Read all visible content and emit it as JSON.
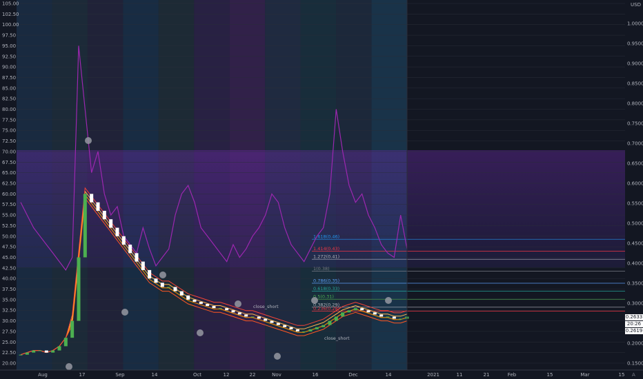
{
  "chart_data": {
    "type": "line",
    "ticker_unit": "USD",
    "y_left": {
      "range": [
        20.0,
        105.0
      ],
      "ticks": [
        "105.00",
        "102.50",
        "100.00",
        "97.50",
        "95.00",
        "92.50",
        "90.00",
        "87.50",
        "85.00",
        "82.50",
        "80.00",
        "77.50",
        "75.00",
        "72.50",
        "70.00",
        "67.50",
        "65.00",
        "62.50",
        "60.00",
        "57.50",
        "55.00",
        "52.50",
        "50.00",
        "47.50",
        "45.00",
        "42.50",
        "40.00",
        "37.50",
        "35.00",
        "32.50",
        "30.00",
        "27.50",
        "25.00",
        "22.50",
        "20.00"
      ]
    },
    "y_right": {
      "range": [
        0.15,
        1.05
      ],
      "ticks": [
        "1.0000",
        "0.9500",
        "0.9000",
        "0.8500",
        "0.8000",
        "0.7500",
        "0.7000",
        "0.6500",
        "0.6000",
        "0.5500",
        "0.5000",
        "0.4500",
        "0.4000",
        "0.3500",
        "0.3000",
        "0.2500",
        "0.2000",
        "0.1500"
      ]
    },
    "x_ticks": [
      "Aug",
      "17",
      "Sep",
      "14",
      "Oct",
      "12",
      "22",
      "Nov",
      "16",
      "Dec",
      "14",
      "2021",
      "11",
      "21",
      "Feb",
      "15",
      "Mar",
      "15"
    ],
    "price_badges": {
      "top": "0.2633",
      "mid": "20:26",
      "bottom": "0.2619"
    },
    "fib_levels": [
      {
        "label": "1.618(0.46)",
        "value": 0.46,
        "color": "#2196f3"
      },
      {
        "label": "1.414(0.43)",
        "value": 0.43,
        "color": "#f23645"
      },
      {
        "label": "1.272(0.41)",
        "value": 0.41,
        "color": "#b2b5be"
      },
      {
        "label": "1(0.38)",
        "value": 0.38,
        "color": "#787b86"
      },
      {
        "label": "0.786(0.35)",
        "value": 0.35,
        "color": "#5b9cf6"
      },
      {
        "label": "0.618(0.33)",
        "value": 0.33,
        "color": "#26a69a"
      },
      {
        "label": "0.5(0.31)",
        "value": 0.31,
        "color": "#4caf50"
      },
      {
        "label": "0.382(0.29)",
        "value": 0.29,
        "color": "#b2b5be"
      },
      {
        "label": "0.236(0.28)",
        "value": 0.28,
        "color": "#f23645"
      }
    ],
    "annotations": [
      "close_short",
      "close_short"
    ],
    "corner_label": "A",
    "colors": {
      "background": "#131722",
      "up": "#4caf50",
      "down": "#ffffff",
      "ema": "#ff9800",
      "macd": "#9c27b0",
      "fib_blue": "#2196f3"
    },
    "price_series": [
      22,
      22.5,
      23,
      23,
      22.5,
      23,
      24,
      26,
      30,
      45,
      60,
      58,
      56,
      54,
      52,
      50,
      48,
      46,
      44,
      42,
      40,
      39,
      38,
      38,
      37,
      36,
      35,
      34.5,
      34,
      33.5,
      33,
      33,
      32.5,
      32,
      31.5,
      31,
      31,
      30.5,
      30,
      29.5,
      29,
      28.5,
      28,
      27.5,
      27.5,
      28,
      28.5,
      29,
      30,
      31,
      32,
      32.5,
      33,
      32.5,
      32,
      31.5,
      31,
      31,
      30.5,
      30.5,
      31
    ],
    "indicator_series": [
      58,
      55,
      52,
      50,
      48,
      46,
      44,
      42,
      45,
      95,
      80,
      65,
      70,
      60,
      55,
      57,
      50,
      48,
      46,
      52,
      47,
      43,
      45,
      47,
      55,
      60,
      62,
      58,
      52,
      50,
      48,
      46,
      44,
      48,
      45,
      47,
      50,
      52,
      55,
      60,
      58,
      52,
      48,
      46,
      44,
      47,
      50,
      52,
      60,
      80,
      70,
      62,
      58,
      60,
      55,
      52,
      48,
      46,
      45,
      55,
      47
    ]
  }
}
